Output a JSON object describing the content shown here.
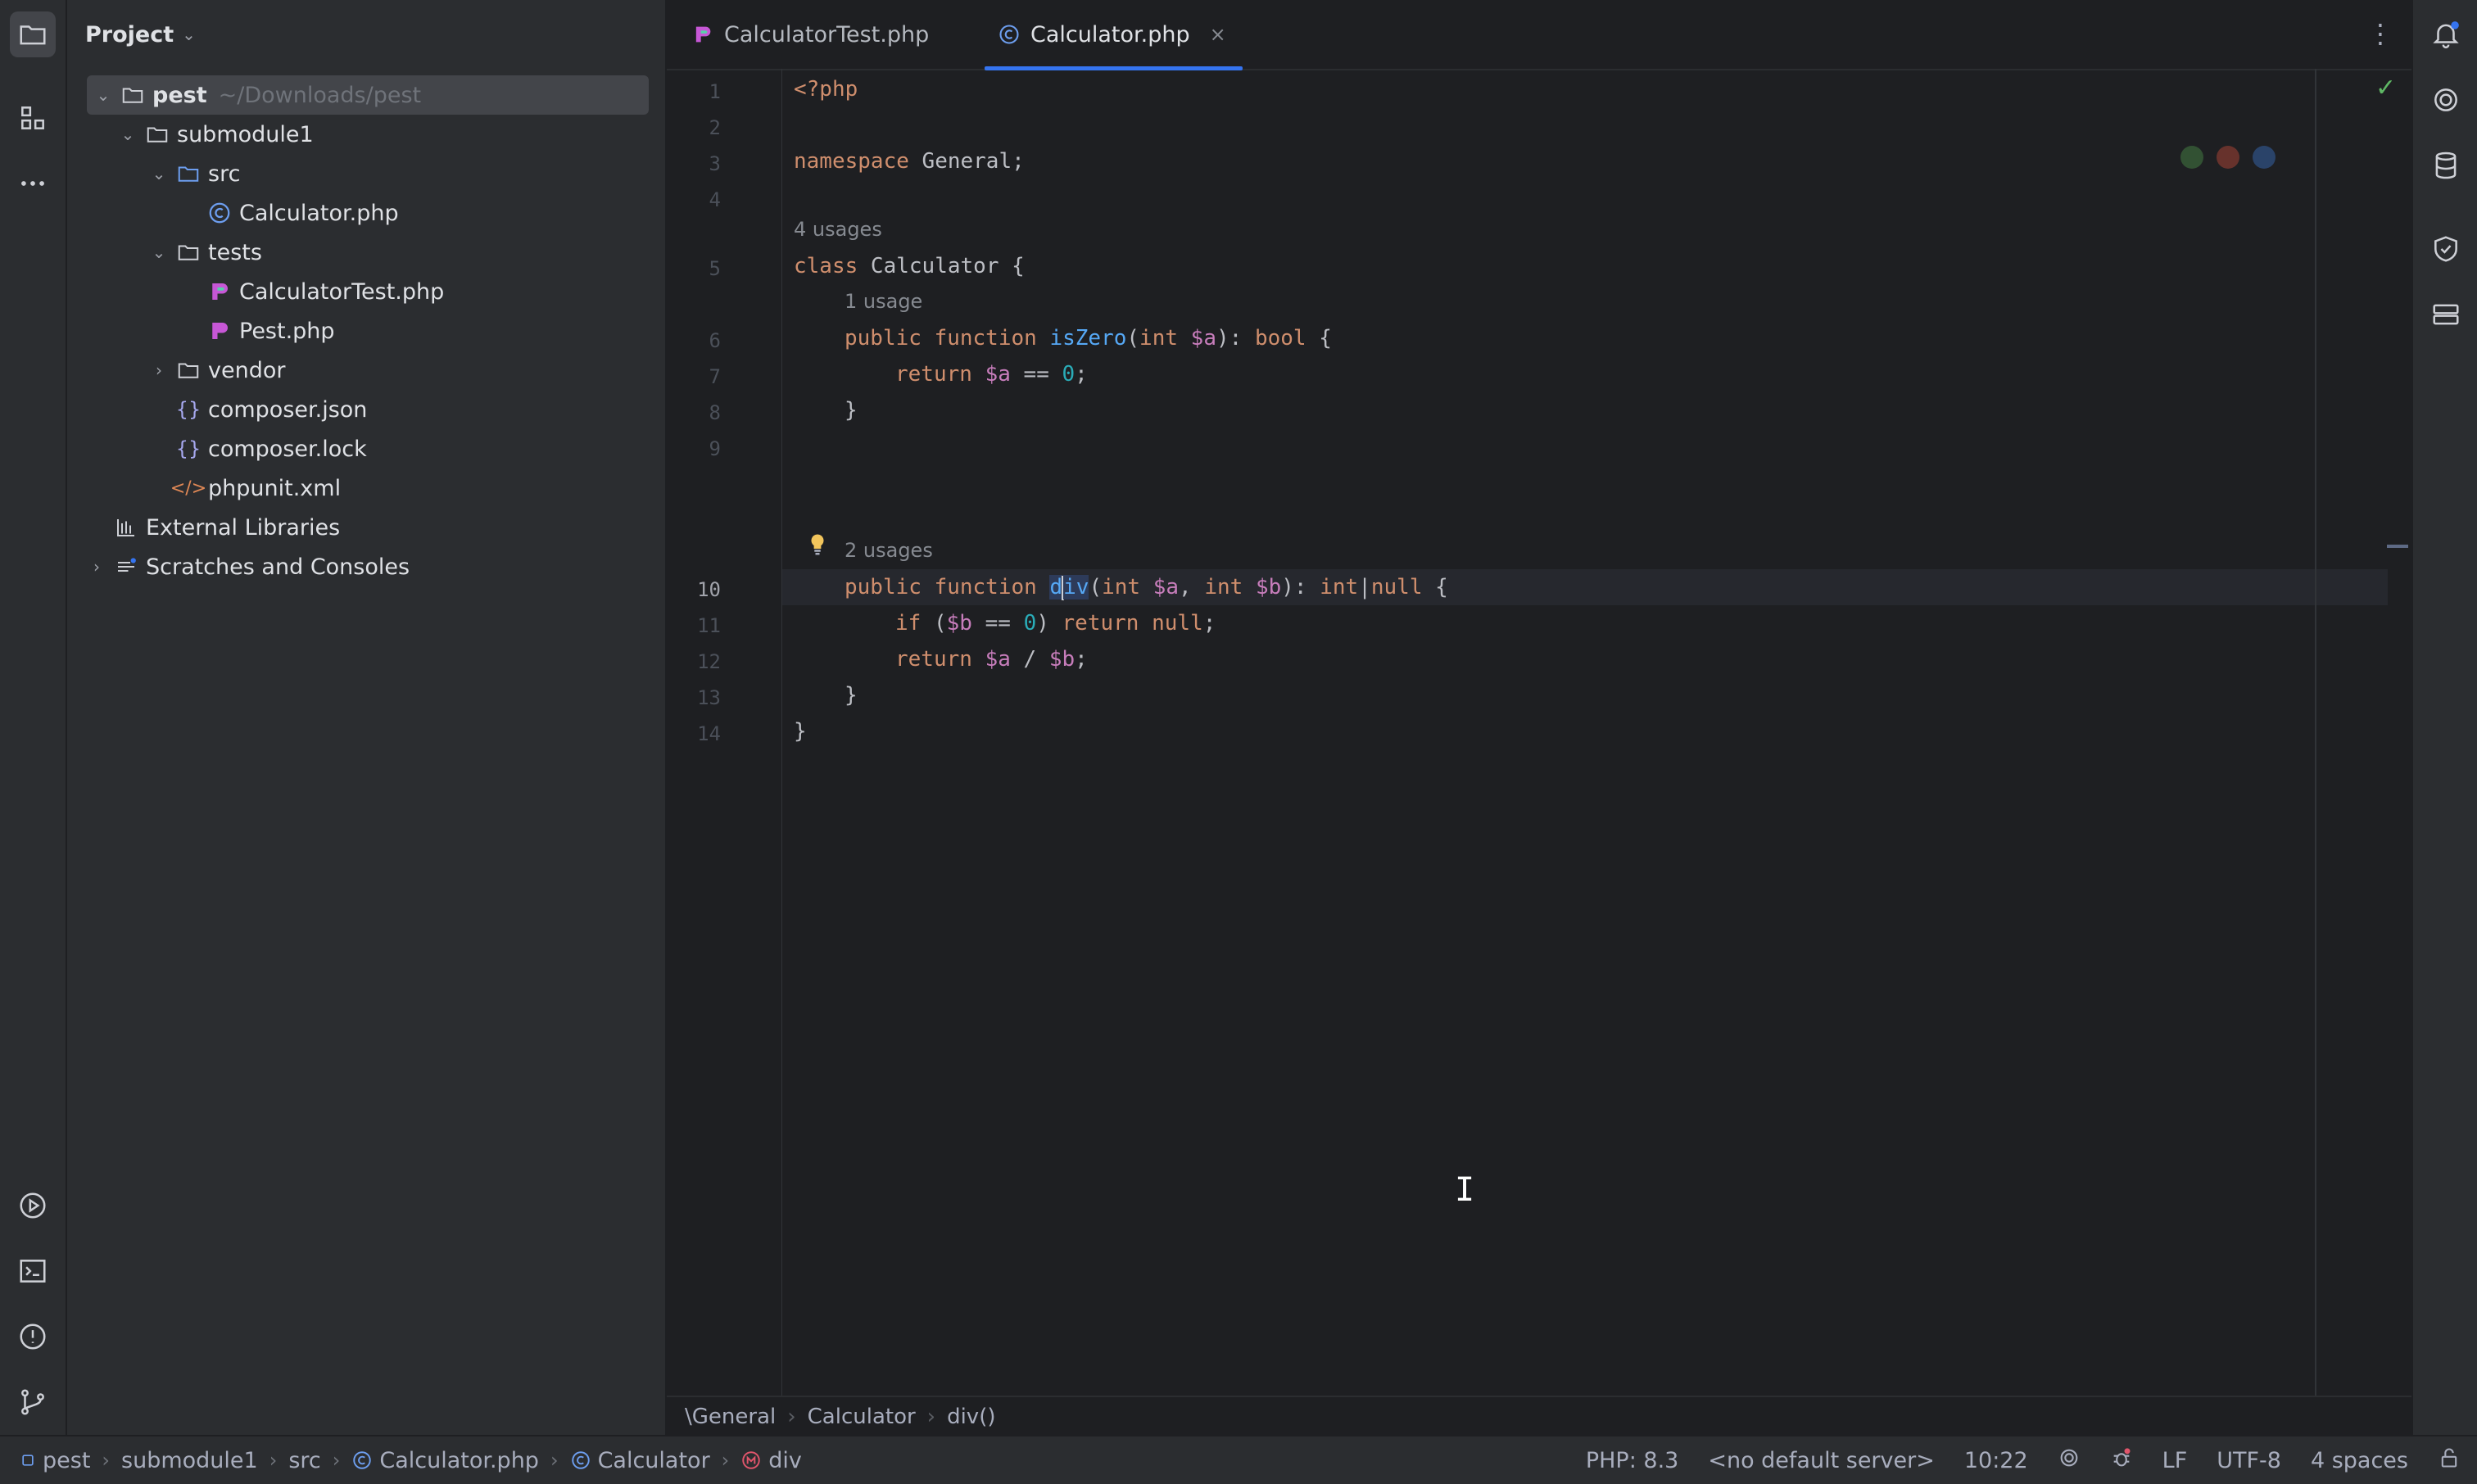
{
  "project_panel": {
    "title": "Project",
    "tree": [
      {
        "label": "pest",
        "path": "~/Downloads/pest",
        "icon": "folder-icon",
        "arrow": "expanded"
      },
      {
        "label": "submodule1",
        "icon": "folder-icon",
        "arrow": "expanded"
      },
      {
        "label": "src",
        "icon": "source-folder-icon",
        "arrow": "expanded"
      },
      {
        "label": "Calculator.php",
        "icon": "php-class-icon"
      },
      {
        "label": "tests",
        "icon": "folder-icon",
        "arrow": "expanded"
      },
      {
        "label": "CalculatorTest.php",
        "icon": "pest-file-icon"
      },
      {
        "label": "Pest.php",
        "icon": "pest-file-icon"
      },
      {
        "label": "vendor",
        "icon": "folder-icon",
        "arrow": "collapsed"
      },
      {
        "label": "composer.json",
        "icon": "json-icon"
      },
      {
        "label": "composer.lock",
        "icon": "json-icon"
      },
      {
        "label": "phpunit.xml",
        "icon": "xml-icon"
      },
      {
        "label": "External Libraries",
        "icon": "library-icon"
      },
      {
        "label": "Scratches and Consoles",
        "icon": "scratches-icon",
        "arrow": "collapsed"
      }
    ]
  },
  "tabs": [
    {
      "label": "CalculatorTest.php",
      "icon": "pest-file-icon",
      "active": false
    },
    {
      "label": "Calculator.php",
      "icon": "php-class-icon",
      "active": true,
      "close": "×"
    }
  ],
  "editor": {
    "line_numbers": [
      "1",
      "2",
      "3",
      "4",
      "5",
      "6",
      "7",
      "8",
      "9",
      "10",
      "11",
      "12",
      "13",
      "14"
    ],
    "current_line": "10",
    "inlays": {
      "class_usages": "4 usages",
      "iszero_usages": "1 usage",
      "div_usages": "2 usages"
    },
    "code": {
      "l1": "<?php",
      "l3_kw": "namespace",
      "l3_rest": " General;",
      "l5_kw": "class",
      "l5_rest": " Calculator {",
      "l6_mod": "public function",
      "l6_name": "isZero",
      "l6_p1": "(",
      "l6_type": "int",
      "l6_var": "$a",
      "l6_p2": "): ",
      "l6_ret": "bool",
      "l6_end": " {",
      "l7_kw": "return",
      "l7_var": "$a",
      "l7_op": " == ",
      "l7_num": "0",
      "l7_end": ";",
      "l8": "}",
      "l10_mod": "public function",
      "l10_name_a": "d",
      "l10_name_b": "iv",
      "l10_p1": "(",
      "l10_t1": "int",
      "l10_v1": "$a",
      "l10_comma": ", ",
      "l10_t2": "int",
      "l10_v2": "$b",
      "l10_p2": "): ",
      "l10_ret1": "int",
      "l10_bar": "|",
      "l10_ret2": "null",
      "l10_end": " {",
      "l11_kw": "if",
      "l11_p1": " (",
      "l11_var": "$b",
      "l11_op": " == ",
      "l11_num": "0",
      "l11_p2": ") ",
      "l11_kw2": "return",
      "l11_null": "null",
      "l11_end": ";",
      "l12_kw": "return",
      "l12_v1": "$a",
      "l12_op": " / ",
      "l12_v2": "$b",
      "l12_end": ";",
      "l13": "}",
      "l14": "}"
    },
    "breadcrumb": [
      "\\General",
      "Calculator",
      "div()"
    ]
  },
  "statusbar": {
    "nav": [
      {
        "label": "pest",
        "icon": "module-icon"
      },
      {
        "label": "submodule1"
      },
      {
        "label": "src"
      },
      {
        "label": "Calculator.php",
        "icon": "php-class-icon"
      },
      {
        "label": "Calculator",
        "icon": "php-class-icon"
      },
      {
        "label": "div",
        "icon": "method-icon"
      }
    ],
    "php_version": "PHP: 8.3",
    "server": "<no default server>",
    "position": "10:22",
    "line_ending": "LF",
    "encoding": "UTF-8",
    "indent": "4 spaces"
  },
  "colors": {
    "accent": "#3574f0",
    "keyword": "#cf8e6d",
    "function": "#56a8f5",
    "variable": "#c77dbb",
    "number": "#2aacb8",
    "success": "#5fb865"
  }
}
